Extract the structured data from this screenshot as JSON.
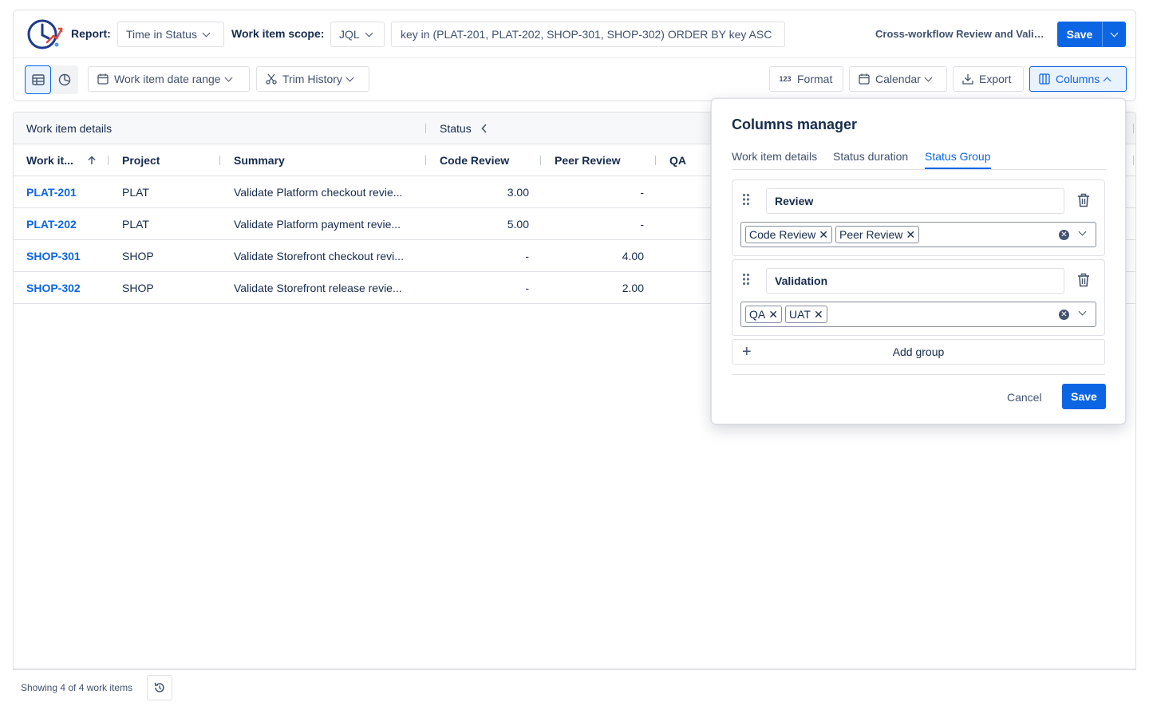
{
  "header": {
    "report_label": "Report:",
    "report_value": "Time in Status",
    "scope_label": "Work item scope:",
    "scope_value": "JQL",
    "jql": "key in (PLAT-201, PLAT-202, SHOP-301, SHOP-302) ORDER BY key ASC",
    "report_name": "Cross-workflow Review and Validation",
    "save_label": "Save"
  },
  "toolbar": {
    "date_range": "Work item date range",
    "trim_history": "Trim History",
    "format": "Format",
    "calendar": "Calendar",
    "export": "Export",
    "columns": "Columns"
  },
  "table": {
    "group_headers": [
      "Work item details",
      "Status"
    ],
    "columns": [
      "Work it...",
      "Project",
      "Summary",
      "Code Review",
      "Peer Review",
      "QA"
    ],
    "rows": [
      {
        "key": "PLAT-201",
        "project": "PLAT",
        "summary": "Validate Platform checkout revie...",
        "code_review": "3.00",
        "peer_review": "-"
      },
      {
        "key": "PLAT-202",
        "project": "PLAT",
        "summary": "Validate Platform payment revie...",
        "code_review": "5.00",
        "peer_review": "-"
      },
      {
        "key": "SHOP-301",
        "project": "SHOP",
        "summary": "Validate Storefront checkout revi...",
        "code_review": "-",
        "peer_review": "4.00"
      },
      {
        "key": "SHOP-302",
        "project": "SHOP",
        "summary": "Validate Storefront release revie...",
        "code_review": "-",
        "peer_review": "2.00"
      }
    ]
  },
  "footer": {
    "showing": "Showing 4 of 4 work items"
  },
  "columns_manager": {
    "title": "Columns manager",
    "tabs": [
      "Work item details",
      "Status duration",
      "Status Group"
    ],
    "active_tab": "Status Group",
    "groups": [
      {
        "name": "Review",
        "statuses": [
          "Code Review",
          "Peer Review"
        ]
      },
      {
        "name": "Validation",
        "statuses": [
          "QA",
          "UAT"
        ]
      }
    ],
    "add_group": "Add group",
    "cancel": "Cancel",
    "save": "Save"
  },
  "colors": {
    "accent": "#0c66e4",
    "text": "#172b4d",
    "subtle": "#42526e",
    "border": "#dfe1e6"
  }
}
